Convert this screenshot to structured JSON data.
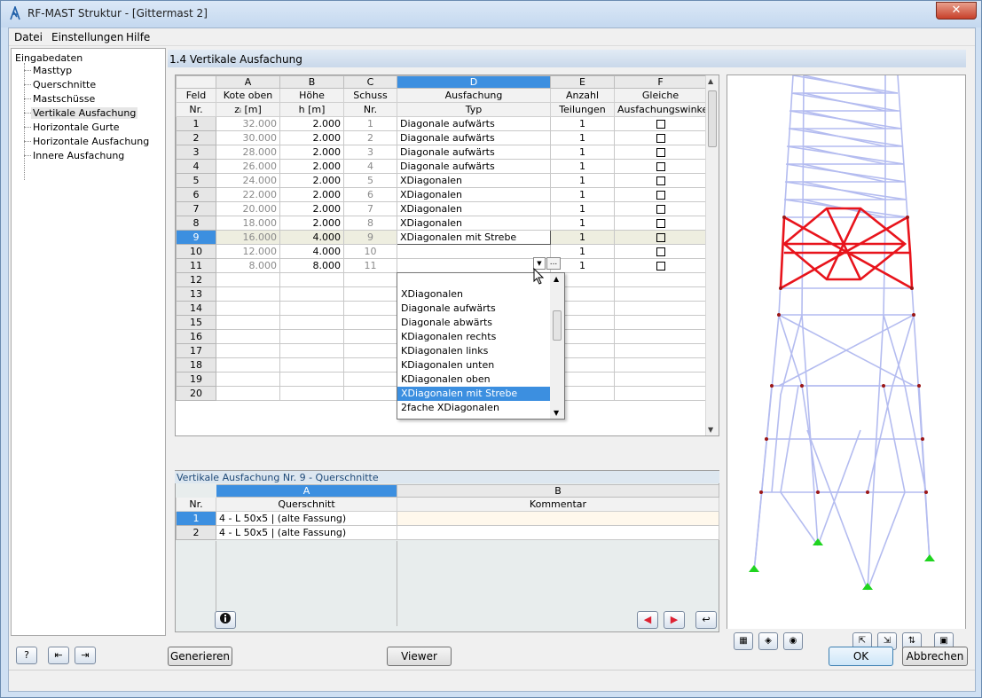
{
  "window": {
    "title": "RF-MAST Struktur - [Gittermast 2]",
    "close_glyph": "✕"
  },
  "menu": [
    "Datei",
    "Einstellungen",
    "Hilfe"
  ],
  "tree": {
    "root": "Eingabedaten",
    "items": [
      "Masttyp",
      "Querschnitte",
      "Mastschüsse",
      "Vertikale Ausfachung",
      "Horizontale Gurte",
      "Horizontale Ausfachung",
      "Innere Ausfachung"
    ],
    "selected_index": 3
  },
  "section_title": "1.4 Vertikale Ausfachung",
  "grid": {
    "col_letters": [
      "A",
      "B",
      "C",
      "D",
      "E",
      "F"
    ],
    "active_letter": "D",
    "headers_line1": [
      "Feld",
      "Kote oben",
      "Höhe",
      "Schuss",
      "Ausfachung",
      "Anzahl",
      "Gleiche"
    ],
    "headers_line2": [
      "Nr.",
      "zᵢ [m]",
      "h [m]",
      "Nr.",
      "Typ",
      "Teilungen",
      "Ausfachungswinkel"
    ],
    "rows": [
      {
        "nr": "1",
        "kote": "32.000",
        "hoehe": "2.000",
        "schuss": "1",
        "typ": "Diagonale aufwärts",
        "anzahl": "1",
        "check": false
      },
      {
        "nr": "2",
        "kote": "30.000",
        "hoehe": "2.000",
        "schuss": "2",
        "typ": "Diagonale aufwärts",
        "anzahl": "1",
        "check": false
      },
      {
        "nr": "3",
        "kote": "28.000",
        "hoehe": "2.000",
        "schuss": "3",
        "typ": "Diagonale aufwärts",
        "anzahl": "1",
        "check": false
      },
      {
        "nr": "4",
        "kote": "26.000",
        "hoehe": "2.000",
        "schuss": "4",
        "typ": "Diagonale aufwärts",
        "anzahl": "1",
        "check": false
      },
      {
        "nr": "5",
        "kote": "24.000",
        "hoehe": "2.000",
        "schuss": "5",
        "typ": "XDiagonalen",
        "anzahl": "1",
        "check": false
      },
      {
        "nr": "6",
        "kote": "22.000",
        "hoehe": "2.000",
        "schuss": "6",
        "typ": "XDiagonalen",
        "anzahl": "1",
        "check": false
      },
      {
        "nr": "7",
        "kote": "20.000",
        "hoehe": "2.000",
        "schuss": "7",
        "typ": "XDiagonalen",
        "anzahl": "1",
        "check": false
      },
      {
        "nr": "8",
        "kote": "18.000",
        "hoehe": "2.000",
        "schuss": "8",
        "typ": "XDiagonalen",
        "anzahl": "1",
        "check": false
      },
      {
        "nr": "9",
        "kote": "16.000",
        "hoehe": "4.000",
        "schuss": "9",
        "typ": "XDiagonalen mit Strebe",
        "anzahl": "1",
        "check": false
      },
      {
        "nr": "10",
        "kote": "12.000",
        "hoehe": "4.000",
        "schuss": "10",
        "typ": "",
        "anzahl": "1",
        "check": false
      },
      {
        "nr": "11",
        "kote": "8.000",
        "hoehe": "8.000",
        "schuss": "11",
        "typ": "",
        "anzahl": "1",
        "check": false
      },
      {
        "nr": "12",
        "kote": "",
        "hoehe": "",
        "schuss": "",
        "typ": "",
        "anzahl": "",
        "check": null
      },
      {
        "nr": "13",
        "kote": "",
        "hoehe": "",
        "schuss": "",
        "typ": "",
        "anzahl": "",
        "check": null
      },
      {
        "nr": "14",
        "kote": "",
        "hoehe": "",
        "schuss": "",
        "typ": "",
        "anzahl": "",
        "check": null
      },
      {
        "nr": "15",
        "kote": "",
        "hoehe": "",
        "schuss": "",
        "typ": "",
        "anzahl": "",
        "check": null
      },
      {
        "nr": "16",
        "kote": "",
        "hoehe": "",
        "schuss": "",
        "typ": "",
        "anzahl": "",
        "check": null
      },
      {
        "nr": "17",
        "kote": "",
        "hoehe": "",
        "schuss": "",
        "typ": "",
        "anzahl": "",
        "check": null
      },
      {
        "nr": "18",
        "kote": "",
        "hoehe": "",
        "schuss": "",
        "typ": "",
        "anzahl": "",
        "check": null
      },
      {
        "nr": "19",
        "kote": "",
        "hoehe": "",
        "schuss": "",
        "typ": "",
        "anzahl": "",
        "check": null
      },
      {
        "nr": "20",
        "kote": "",
        "hoehe": "",
        "schuss": "",
        "typ": "",
        "anzahl": "",
        "check": null
      }
    ],
    "selected_row": "9",
    "ellipsis": "..."
  },
  "dropdown": {
    "options": [
      "",
      "XDiagonalen",
      "Diagonale aufwärts",
      "Diagonale abwärts",
      "KDiagonalen rechts",
      "KDiagonalen links",
      "KDiagonalen unten",
      "KDiagonalen oben",
      "XDiagonalen mit Strebe",
      "2fache XDiagonalen"
    ],
    "selected": "XDiagonalen mit Strebe"
  },
  "subgrid": {
    "title": "Vertikale Ausfachung Nr. 9  -  Querschnitte",
    "col_letters": [
      "A",
      "B"
    ],
    "headers": [
      "Nr.",
      "Querschnitt",
      "Kommentar"
    ],
    "rows": [
      {
        "nr": "1",
        "querschnitt": "4 - L 50x5 | (alte Fassung)",
        "kommentar": ""
      },
      {
        "nr": "2",
        "querschnitt": "4 - L 50x5 | (alte Fassung)",
        "kommentar": ""
      }
    ]
  },
  "buttons": {
    "generate": "Generieren",
    "viewer": "Viewer",
    "ok": "OK",
    "cancel": "Abbrechen"
  },
  "colors": {
    "accent": "#3c8fe0",
    "highlight_red": "#e8141c",
    "mast_lines": "#aab4ee"
  }
}
